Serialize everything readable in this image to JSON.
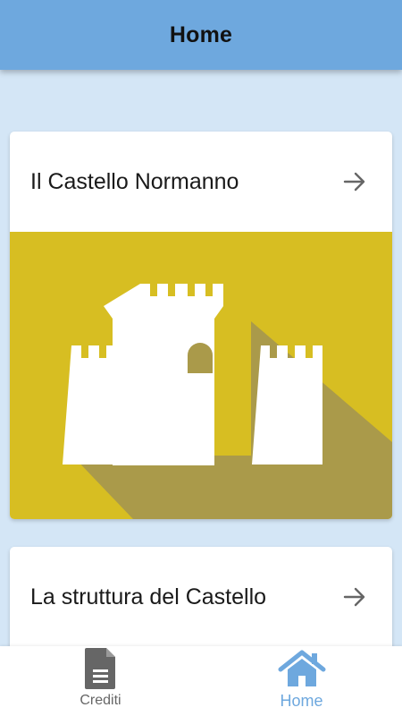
{
  "app_bar": {
    "title": "Home"
  },
  "cards": [
    {
      "title": "Il Castello Normanno",
      "image": "castle-illustration",
      "image_color": "#d7be22"
    },
    {
      "title": "La struttura del Castello"
    }
  ],
  "bottom_nav": {
    "items": [
      {
        "label": "Crediti",
        "icon": "document-icon",
        "active": false
      },
      {
        "label": "Home",
        "icon": "home-icon",
        "active": true
      }
    ]
  },
  "colors": {
    "app_bar": "#6ea8de",
    "background": "#d4e6f6",
    "accent": "#6ea8de",
    "castle_background": "#d7be22",
    "castle_shadow": "#aa9a4a"
  }
}
